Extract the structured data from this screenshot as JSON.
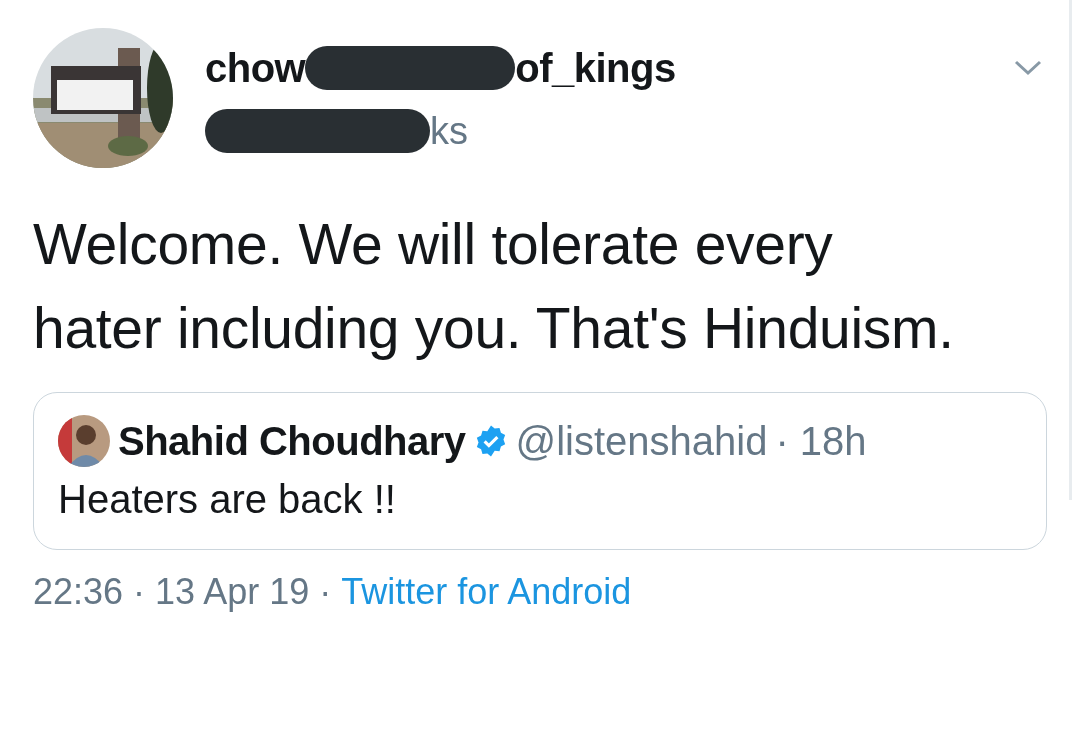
{
  "author": {
    "name_start": "chow",
    "name_end": "of_kings",
    "handle_end": "ks"
  },
  "tweet_text": "Welcome. We will tolerate every hater including you. That's Hinduism.",
  "quoted_tweet": {
    "name": "Shahid Choudhary",
    "verified": true,
    "handle": "@listenshahid",
    "time": "· 18h",
    "text": "Heaters are back !!"
  },
  "meta": {
    "timestamp": "22:36 · 13 Apr 19 ·",
    "source": "Twitter for Android"
  }
}
